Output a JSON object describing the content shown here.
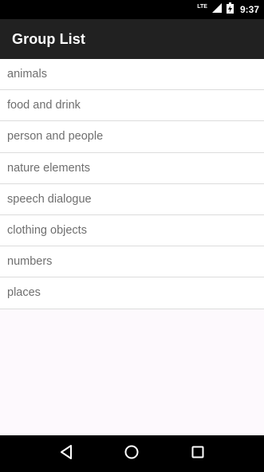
{
  "status_bar": {
    "network_label": "LTE",
    "time": "9:37",
    "icons": [
      "signal-icon",
      "battery-icon"
    ]
  },
  "app_bar": {
    "title": "Group List"
  },
  "groups": [
    {
      "label": "animals"
    },
    {
      "label": "food and drink"
    },
    {
      "label": "person and people"
    },
    {
      "label": "nature elements"
    },
    {
      "label": "speech dialogue"
    },
    {
      "label": "clothing objects"
    },
    {
      "label": "numbers"
    },
    {
      "label": "places"
    }
  ],
  "nav_bar": {
    "buttons": [
      "back-icon",
      "home-icon",
      "recents-icon"
    ]
  },
  "colors": {
    "status_bar": "#000000",
    "app_bar": "#212121",
    "list_text": "#6f6f6f",
    "divider": "#dcdcdc",
    "background": "#fdf9fd"
  }
}
